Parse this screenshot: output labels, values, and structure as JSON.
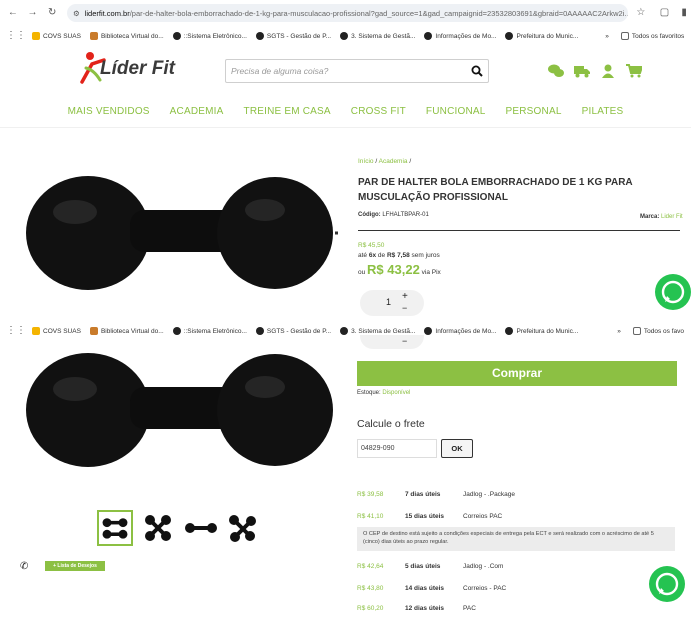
{
  "browser": {
    "url_host": "liderfit.com.br",
    "url_rest": "/par-de-halter-bola-emborrachado-de-1-kg-para-musculacao-profissional?gad_source=1&gad_campaignid=23532803691&gbraid=0AAAAAC2Arkw2i...",
    "bookmarks": [
      "COVS SUAS",
      "Biblioteca Virtual do...",
      "::Sistema Eletrônico...",
      "SGTS - Gestão de P...",
      "3. Sistema de Gestã...",
      "Informações de Mo...",
      "Prefeitura do Munic..."
    ],
    "bookmarks_more": "»",
    "bookmarks_folder": "Todos os favoritos",
    "bookmarks_folder_short": "Todos os favo"
  },
  "site": {
    "logo_text": "Líder Fit",
    "search_placeholder": "Precisa de alguma coisa?",
    "nav": [
      "MAIS VENDIDOS",
      "ACADEMIA",
      "TREINE EM CASA",
      "CROSS FIT",
      "FUNCIONAL",
      "PERSONAL",
      "PILATES"
    ]
  },
  "product": {
    "breadcrumb_home": "Início",
    "breadcrumb_sep": "/",
    "breadcrumb_cat": "Academia",
    "title": "PAR DE HALTER BOLA EMBORRACHADO DE 1 KG PARA MUSCULAÇÃO PROFISSIONAL",
    "code_label": "Código:",
    "code_value": "LFHALTBPAR-01",
    "brand_label": "Marca:",
    "brand_value": "Lider Fit",
    "price_old": "R$ 45,50",
    "installments_prefix": "até",
    "installments_count": "6x",
    "installments_mid": "de",
    "installments_value": "R$ 7,58",
    "installments_suffix": "sem juros",
    "pix_prefix": "ou",
    "price_pix": "R$ 43,22",
    "pix_suffix": "via Pix",
    "qty": "1",
    "qty_plus": "+",
    "qty_minus": "−",
    "buy_label": "Comprar",
    "stock_label": "Estoque:",
    "stock_value": "Disponível",
    "wishlist_label": "+ Lista de Desejos"
  },
  "shipping": {
    "title": "Calcule o frete",
    "cep_value": "04829-090",
    "ok_label": "OK",
    "rows": [
      {
        "price": "R$ 39,58",
        "days": "7 dias úteis",
        "carrier": "Jadlog - .Package"
      },
      {
        "price": "R$ 41,10",
        "days": "15 dias úteis",
        "carrier": "Correios PAC"
      },
      {
        "price": "R$ 42,64",
        "days": "5 dias úteis",
        "carrier": "Jadlog - .Com"
      },
      {
        "price": "R$ 43,80",
        "days": "14 dias úteis",
        "carrier": "Correios - PAC"
      },
      {
        "price": "R$ 60,20",
        "days": "12 dias úteis",
        "carrier": "PAC"
      }
    ],
    "note": "O CEP de destino está sujeito a condições especiais de entrega pela ECT e será realizado com o acréscimo de até 5 (cinco) dias úteis ao prazo regular."
  },
  "colors": {
    "brand_green": "#8cc043",
    "whatsapp": "#25c351",
    "logo_red": "#e2231a"
  },
  "icons": [
    "chat-icon",
    "truck-icon",
    "user-icon",
    "cart-icon",
    "search-icon",
    "whatsapp-icon"
  ]
}
